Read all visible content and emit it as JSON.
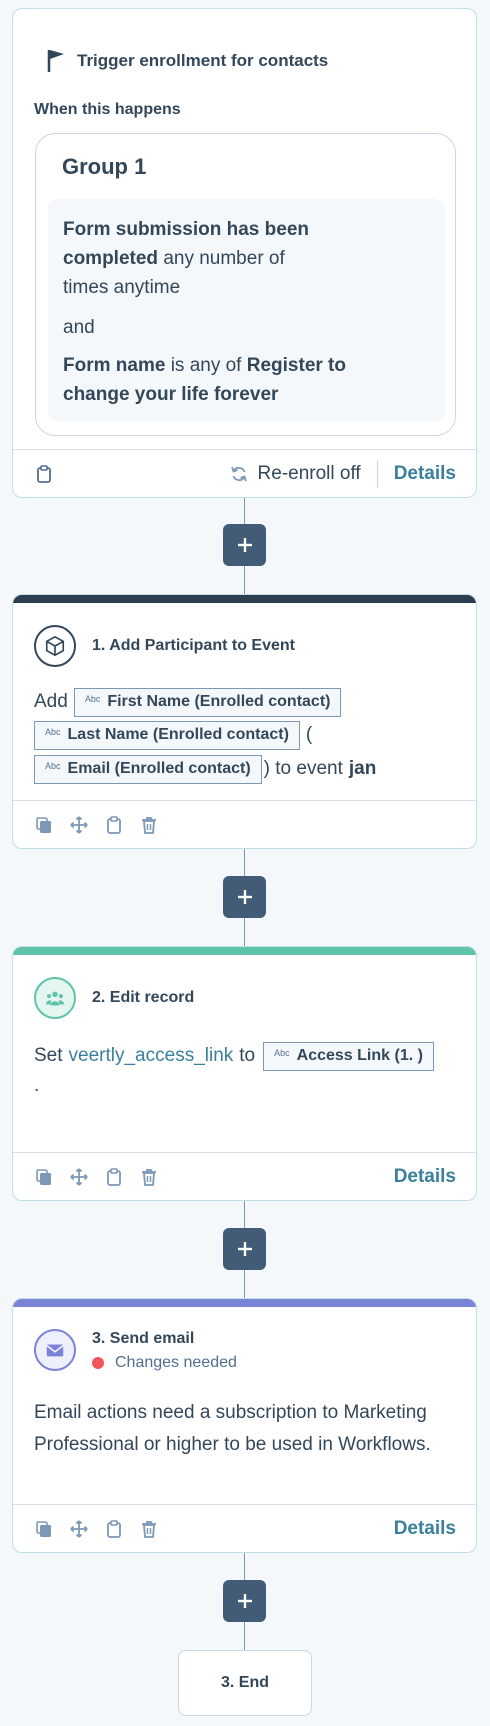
{
  "trigger": {
    "title": "Trigger enrollment for contacts",
    "when_label": "When this happens",
    "group_title": "Group 1",
    "criteria_1_bold": "Form submission has been completed",
    "criteria_1_rest": "any number of times anytime",
    "and_label": "and",
    "criteria_2_field": "Form name",
    "criteria_2_op": "is any of",
    "criteria_2_value": "Register to change your life forever",
    "reenroll_label": "Re-enroll off",
    "details_label": "Details"
  },
  "action1": {
    "title": "1. Add Participant to Event",
    "add_label": "Add",
    "token_first": "First Name (Enrolled contact)",
    "token_last": "Last Name (Enrolled contact)",
    "paren_open": "(",
    "token_email": "Email (Enrolled contact)",
    "to_event": ") to event",
    "event_name": "jan",
    "accent": "#2d3e50"
  },
  "action2": {
    "title": "2. Edit record",
    "set_label": "Set",
    "property": "veertly_access_link",
    "to_label": "to",
    "token_value": "Access Link (1. )",
    "period": ".",
    "details_label": "Details",
    "accent": "#5ec3a9"
  },
  "action3": {
    "title": "3. Send email",
    "status": "Changes needed",
    "status_color": "#f2545b",
    "message": "Email actions need a subscription to Marketing Professional or higher to be used in Workflows.",
    "details_label": "Details",
    "accent": "#7b83d6"
  },
  "abc_label": "Abc",
  "end_label": "3. End",
  "icons": [
    "flag-icon",
    "clipboard-icon",
    "refresh-icon",
    "copy-icon",
    "move-icon",
    "delete-icon",
    "plus-icon",
    "cube-icon",
    "people-icon",
    "mail-icon"
  ]
}
